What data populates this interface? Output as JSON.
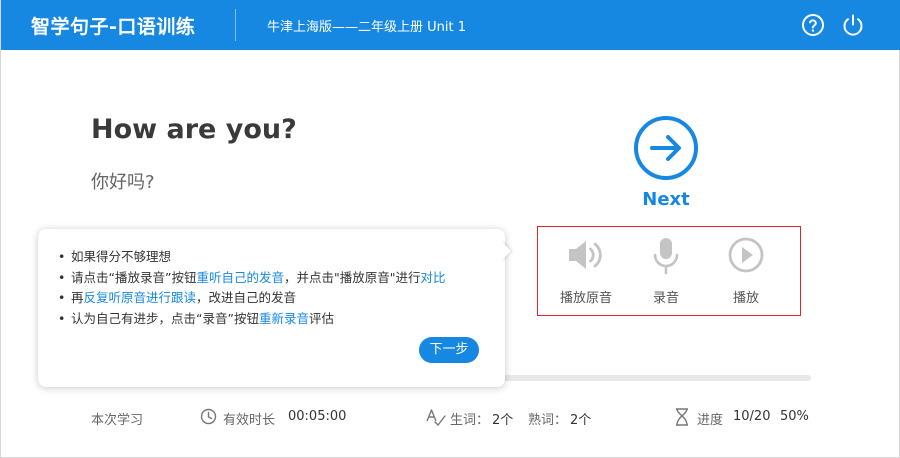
{
  "header": {
    "app_title": "智学句子-口语训练",
    "book_title": "牛津上海版——二年级上册 Unit 1",
    "help_icon": "help-circle-icon",
    "power_icon": "power-icon"
  },
  "sentence": {
    "english": "How are you?",
    "chinese": "你好吗?"
  },
  "next": {
    "label": "Next",
    "icon": "arrow-right-circle-icon"
  },
  "controls": [
    {
      "label": "播放原音",
      "icon": "speaker-icon"
    },
    {
      "label": "录音",
      "icon": "microphone-icon"
    },
    {
      "label": "播放",
      "icon": "play-circle-icon"
    }
  ],
  "tooltip": {
    "line1": "如果得分不够理想",
    "line2_a": "请点击“播放录音”按钮",
    "line2_b": "重听自己的发音",
    "line2_c": "，并点击\"播放原音\"进行",
    "line2_d": "对比",
    "line3_a": "再",
    "line3_b": "反复听原音进行跟读",
    "line3_c": "，改进自己的发音",
    "line4_a": "认为自己有进步，点击“录音”按钮",
    "line4_b": "重新录音",
    "line4_c": "评估",
    "next_step_label": "下一步"
  },
  "footer": {
    "study_label": "本次学习",
    "duration_label": "有效时长",
    "duration_value": "00:05:00",
    "new_words_label": "生词：",
    "new_words_value": "2个",
    "known_words_label": "熟词：",
    "known_words_value": "2个",
    "progress_label": "进度",
    "progress_count": "10/20",
    "progress_percent": "50%"
  },
  "progress_fraction": 0.5,
  "colors": {
    "accent": "#1688e2",
    "highlight_box": "#e0242d",
    "icon_gray": "#c4c4c4"
  }
}
